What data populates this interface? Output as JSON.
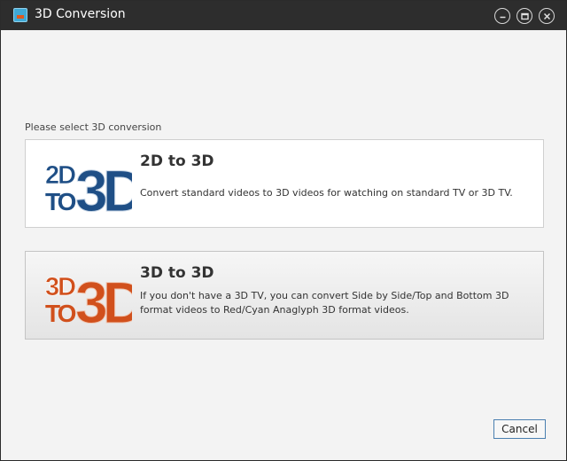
{
  "window": {
    "title": "3D Conversion"
  },
  "prompt": "Please select 3D conversion",
  "options": [
    {
      "title": "2D to 3D",
      "description": "Convert standard videos to 3D videos for watching on standard TV or 3D TV.",
      "logo_top": "2D",
      "logo_to": "TO",
      "logo_big": "3D",
      "logo_color": "#1f4f86"
    },
    {
      "title": "3D to 3D",
      "description": "If you don't have a 3D TV, you can convert Side by Side/Top and Bottom 3D format videos to Red/Cyan Anaglyph 3D format videos.",
      "logo_top": "3D",
      "logo_to": "TO",
      "logo_big": "3D",
      "logo_color": "#d1501c"
    }
  ],
  "cancel_label": "Cancel",
  "icons": {
    "app": "app-film-icon",
    "minimize": "minimize-icon",
    "maximize": "maximize-icon",
    "close": "close-icon"
  }
}
